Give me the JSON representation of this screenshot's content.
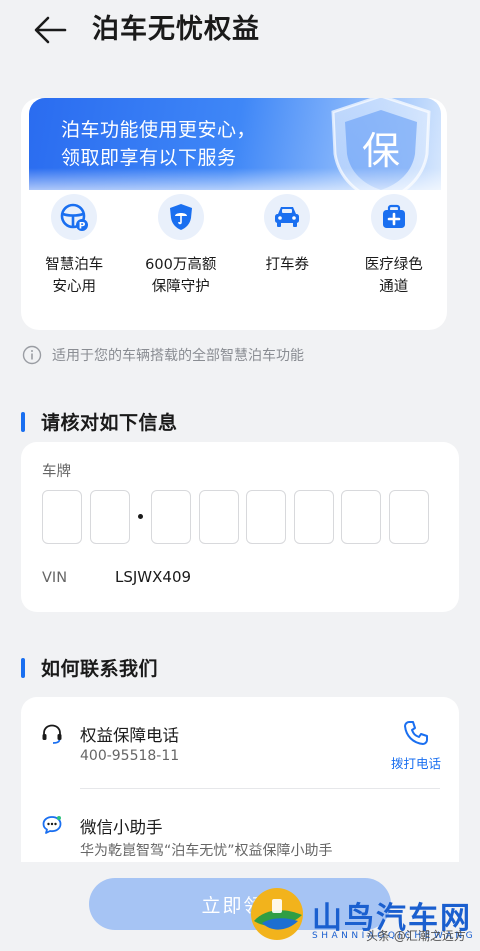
{
  "header": {
    "title": "泊车无忧权益"
  },
  "banner": {
    "line1": "泊车功能使用更安心，",
    "line2": "领取即享有以下服务",
    "shield_char": "保"
  },
  "services": [
    {
      "label": "智慧泊车\n安心用",
      "icon": "steering-wheel-icon"
    },
    {
      "label": "600万高额\n保障守护",
      "icon": "shield-umbrella-icon"
    },
    {
      "label": "打车券",
      "icon": "car-icon"
    },
    {
      "label": "医疗绿色\n通道",
      "icon": "medical-kit-icon"
    }
  ],
  "info_note": "适用于您的车辆搭载的全部智慧泊车功能",
  "verify": {
    "section_title": "请核对如下信息",
    "plate_label": "车牌",
    "vin_label": "VIN",
    "vin_value": "LSJWX409"
  },
  "contact": {
    "section_title": "如何联系我们",
    "hotline_title": "权益保障电话",
    "hotline_number": "400-95518-11",
    "call_label": "拨打电话",
    "wechat_title": "微信小助手",
    "wechat_desc": "华为乾崑智驾“泊车无忧”权益保障小助手"
  },
  "claim_button": {
    "label": "立即领"
  },
  "watermark": {
    "brand": "山鸟汽车网",
    "brand_en": "SHANNIAOQICHEWANG",
    "credit": "头条 @汇潮之远方"
  },
  "colors": {
    "accent": "#1a6ff0",
    "banner_start": "#2a6cf0",
    "button": "#a6c4f4",
    "background": "#f1f2f4"
  }
}
